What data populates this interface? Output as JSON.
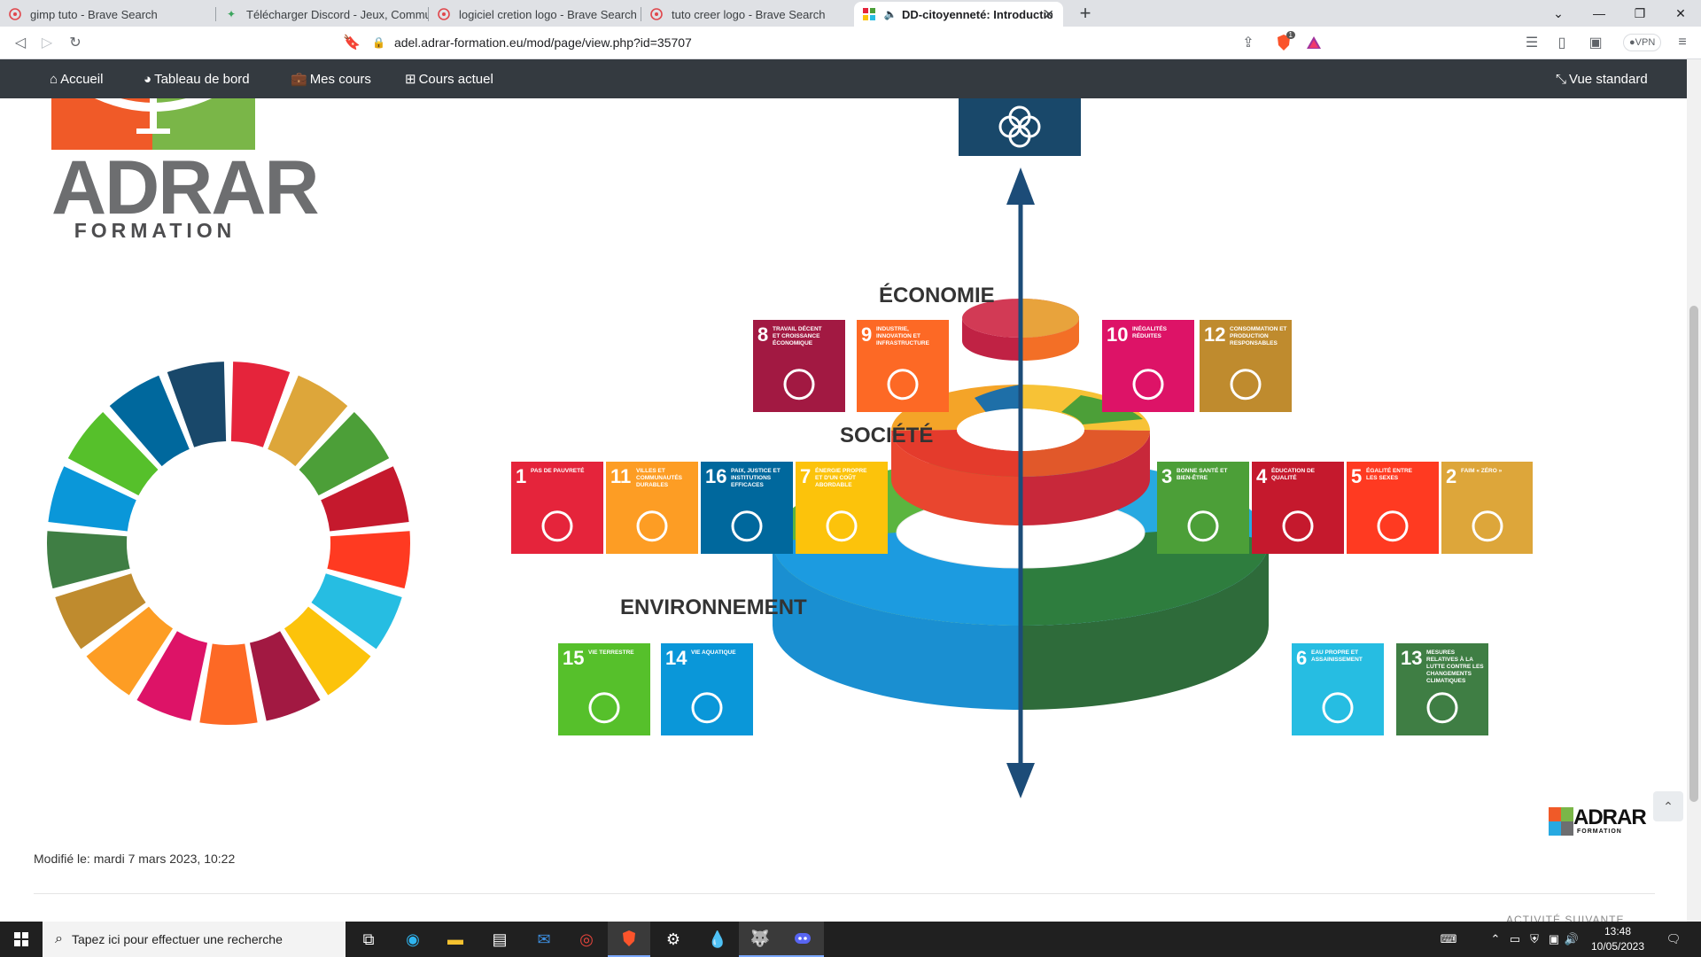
{
  "tabs": [
    {
      "title": "gimp tuto - Brave Search",
      "icon": "brave-search-icon"
    },
    {
      "title": "Télécharger Discord - Jeux, Communic",
      "icon": "discord-favicon"
    },
    {
      "title": "logiciel cretion logo - Brave Search",
      "icon": "brave-search-icon"
    },
    {
      "title": "tuto creer logo - Brave Search",
      "icon": "brave-search-icon"
    },
    {
      "title": "DD-citoyenneté: Introduction à",
      "icon": "moodle-favicon",
      "active": true
    }
  ],
  "toolbar": {
    "url": "adel.adrar-formation.eu/mod/page/view.php?id=35707",
    "vpn_label": "VPN",
    "shields_badge": "1"
  },
  "site_nav": {
    "items": [
      {
        "label": "Accueil",
        "icon": "home-icon"
      },
      {
        "label": "Tableau de bord",
        "icon": "dashboard-icon"
      },
      {
        "label": "Mes cours",
        "icon": "briefcase-icon"
      },
      {
        "label": "Cours actuel",
        "icon": "sitemap-icon"
      }
    ],
    "right_label": "Vue standard",
    "right_icon": "compress-icon"
  },
  "content": {
    "logo_line1": "ADRAR",
    "logo_line2": "FORMATION",
    "diagram": {
      "economie": "ÉCONOMIE",
      "societe": "SOCIÉTÉ",
      "environnement": "ENVIRONNEMENT",
      "sdgs": [
        {
          "n": "8",
          "label": "TRAVAIL DÉCENT ET CROISSANCE ÉCONOMIQUE",
          "color": "#a21942"
        },
        {
          "n": "9",
          "label": "INDUSTRIE, INNOVATION ET INFRASTRUCTURE",
          "color": "#fd6925"
        },
        {
          "n": "10",
          "label": "INÉGALITÉS RÉDUITES",
          "color": "#dd1367"
        },
        {
          "n": "12",
          "label": "CONSOMMATION ET PRODUCTION RESPONSABLES",
          "color": "#bf8b2e"
        },
        {
          "n": "1",
          "label": "PAS DE PAUVRETÉ",
          "color": "#e5243b"
        },
        {
          "n": "11",
          "label": "VILLES ET COMMUNAUTÉS DURABLES",
          "color": "#fd9d24"
        },
        {
          "n": "16",
          "label": "PAIX, JUSTICE ET INSTITUTIONS EFFICACES",
          "color": "#00689d"
        },
        {
          "n": "7",
          "label": "ÉNERGIE PROPRE ET D'UN COÛT ABORDABLE",
          "color": "#fcc30b"
        },
        {
          "n": "3",
          "label": "BONNE SANTÉ ET BIEN-ÊTRE",
          "color": "#4c9f38"
        },
        {
          "n": "4",
          "label": "ÉDUCATION DE QUALITÉ",
          "color": "#c5192d"
        },
        {
          "n": "5",
          "label": "ÉGALITÉ ENTRE LES SEXES",
          "color": "#ff3a21"
        },
        {
          "n": "2",
          "label": "FAIM « ZÉRO »",
          "color": "#dda63a"
        },
        {
          "n": "15",
          "label": "VIE TERRESTRE",
          "color": "#56c02b"
        },
        {
          "n": "14",
          "label": "VIE AQUATIQUE",
          "color": "#0a97d9"
        },
        {
          "n": "6",
          "label": "EAU PROPRE ET ASSAINISSEMENT",
          "color": "#26bde2"
        },
        {
          "n": "13",
          "label": "MESURES RELATIVES À LA LUTTE CONTRE LES CHANGEMENTS CLIMATIQUES",
          "color": "#3f7e44"
        }
      ]
    },
    "small_logo": "ADRAR",
    "small_logo_sub": "FORMATION",
    "modified": "Modifié le: mardi 7 mars 2023, 10:22",
    "next_activity": "ACTIVITÉ SUIVANTE"
  },
  "taskbar": {
    "search_placeholder": "Tapez ici pour effectuer une recherche",
    "time": "13:48",
    "date": "10/05/2023"
  },
  "colors": {
    "nav_bg": "#343a40",
    "tab_strip": "#dfe1e5",
    "taskbar": "#202020"
  }
}
